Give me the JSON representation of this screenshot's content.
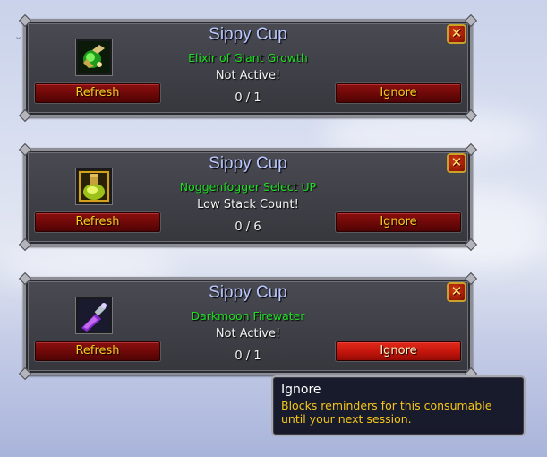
{
  "panels": [
    {
      "title": "Sippy Cup",
      "item_name": "Elixir of Giant Growth",
      "status": "Not Active!",
      "count": "0 / 1",
      "refresh_label": "Refresh",
      "ignore_label": "Ignore",
      "close_label": "✕",
      "icon": "green-elixir-icon"
    },
    {
      "title": "Sippy Cup",
      "item_name": "Noggenfogger Select UP",
      "status": "Low Stack Count!",
      "count": "0 / 6",
      "refresh_label": "Refresh",
      "ignore_label": "Ignore",
      "close_label": "✕",
      "icon": "yellow-potion-icon"
    },
    {
      "title": "Sippy Cup",
      "item_name": "Darkmoon Firewater",
      "status": "Not Active!",
      "count": "0 / 1",
      "refresh_label": "Refresh",
      "ignore_label": "Ignore",
      "close_label": "✕",
      "icon": "purple-bottle-icon"
    }
  ],
  "tooltip": {
    "title": "Ignore",
    "description": "Blocks reminders for this consumable until your next session."
  },
  "colors": {
    "title": "#b9c6ff",
    "item_name": "#1ede22",
    "button_text": "#f6cf1e",
    "tooltip_desc": "#f5c518"
  }
}
